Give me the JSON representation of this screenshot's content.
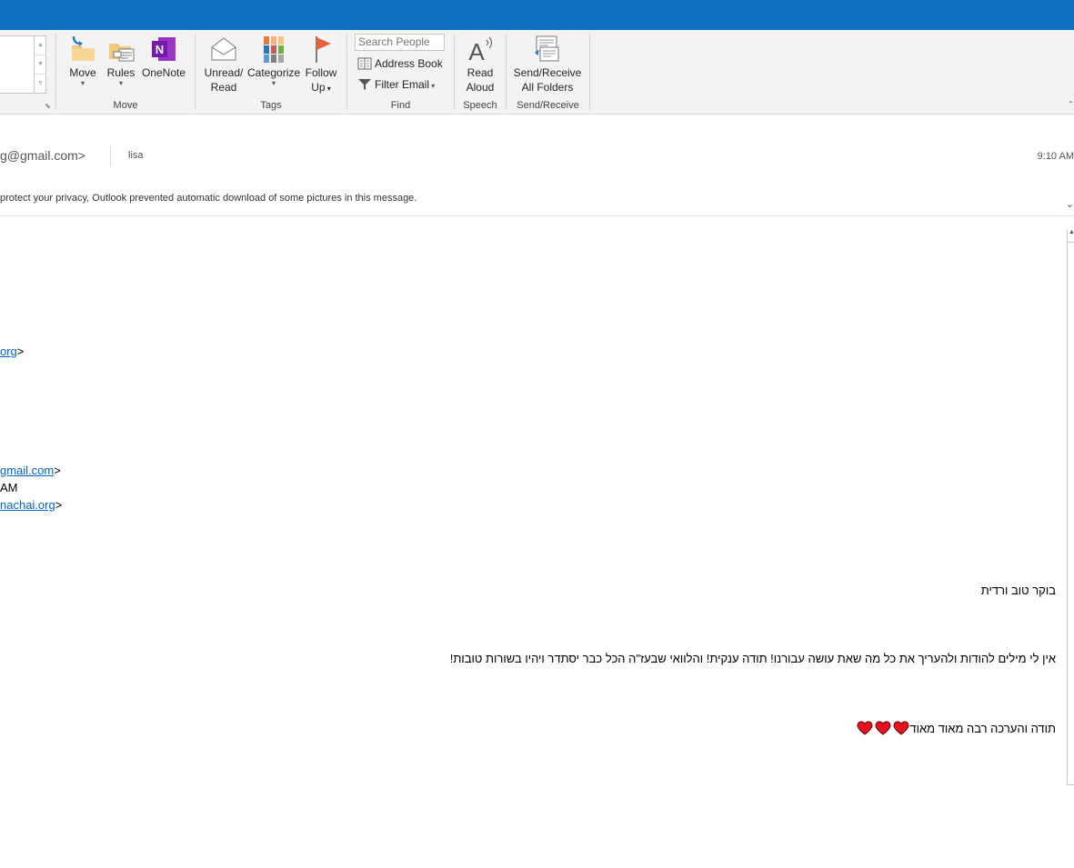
{
  "ribbon": {
    "move_group": {
      "move": "Move",
      "rules": "Rules",
      "onenote": "OneNote",
      "label": "Move"
    },
    "tags_group": {
      "unread_read_line1": "Unread/",
      "unread_read_line2": "Read",
      "categorize": "Categorize",
      "follow_up_line1": "Follow",
      "follow_up_line2": "Up",
      "label": "Tags"
    },
    "find_group": {
      "search_people_placeholder": "Search People",
      "address_book": "Address Book",
      "filter_email": "Filter Email",
      "label": "Find"
    },
    "speech_group": {
      "read_aloud_line1": "Read",
      "read_aloud_line2": "Aloud",
      "label": "Speech"
    },
    "send_receive_group": {
      "line1": "Send/Receive",
      "line2": "All Folders",
      "label": "Send/Receive"
    }
  },
  "message": {
    "from_partial": "g@gmail.com>",
    "to": "lisa",
    "time_partial": "9:10 AM",
    "info_bar": "protect your privacy, Outlook prevented automatic download of some pictures in this message."
  },
  "body": {
    "line_org_link": "org",
    "line_org_suffix": ">",
    "line_gmail_link": "gmail.com",
    "line_gmail_suffix": ">",
    "line_am": "AM",
    "line_nachai_link": "nachai.org",
    "line_nachai_suffix": ">",
    "greeting": "בוקר טוב ורדית",
    "paragraph": "אין לי מילים להודות ולהעריך את כל מה שאת עושה עבורנו! תודה ענקית! והלוואי שבעז\"ה הכל כבר יסתדר ויהיו בשורות טובות!",
    "closing": "תודה והערכה רבה מאוד מאוד",
    "heart_count": 3
  },
  "colors": {
    "titlebar": "#106ebe",
    "link": "#0563c1",
    "heart": "#e81123"
  }
}
